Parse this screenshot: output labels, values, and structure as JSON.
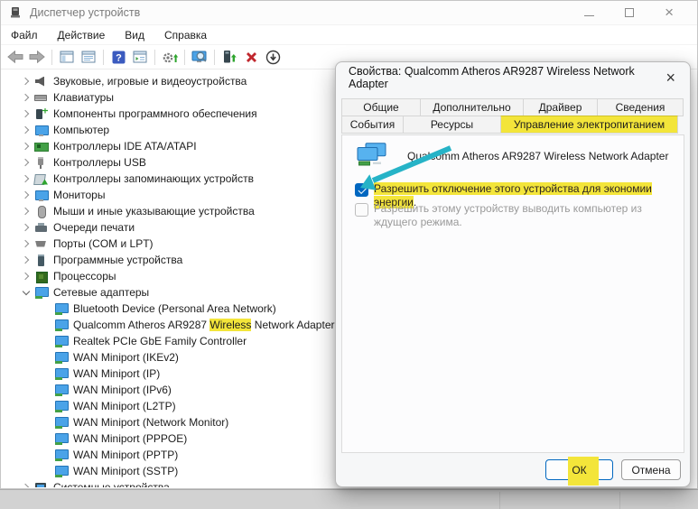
{
  "window": {
    "title": "Диспетчер устройств"
  },
  "menu": {
    "items": [
      "Файл",
      "Действие",
      "Вид",
      "Справка"
    ]
  },
  "toolbar": {
    "icons": [
      "back",
      "forward",
      "show-console-tree",
      "show-action-pane",
      "help",
      "export-list",
      "update-driver-settings",
      "scan-hardware-changes",
      "update-driver",
      "uninstall-device",
      "disable-device"
    ]
  },
  "tree": {
    "items": [
      {
        "label": "Звуковые, игровые и видеоустройства",
        "state": "collapsed"
      },
      {
        "label": "Клавиатуры",
        "state": "collapsed"
      },
      {
        "label": "Компоненты программного обеспечения",
        "state": "collapsed"
      },
      {
        "label": "Компьютер",
        "state": "collapsed"
      },
      {
        "label": "Контроллеры IDE ATA/ATAPI",
        "state": "collapsed"
      },
      {
        "label": "Контроллеры USB",
        "state": "collapsed"
      },
      {
        "label": "Контроллеры запоминающих устройств",
        "state": "collapsed"
      },
      {
        "label": "Мониторы",
        "state": "collapsed"
      },
      {
        "label": "Мыши и иные указывающие устройства",
        "state": "collapsed"
      },
      {
        "label": "Очереди печати",
        "state": "collapsed"
      },
      {
        "label": "Порты (COM и LPT)",
        "state": "collapsed"
      },
      {
        "label": "Программные устройства",
        "state": "collapsed"
      },
      {
        "label": "Процессоры",
        "state": "collapsed"
      },
      {
        "label": "Сетевые адаптеры",
        "state": "expanded"
      },
      {
        "label": "Bluetooth Device (Personal Area Network)",
        "state": "child"
      },
      {
        "label_pre": "Qualcomm Atheros AR9287 ",
        "label_highlight": "Wireless",
        "label_post": " Network Adapter",
        "state": "child"
      },
      {
        "label": "Realtek PCIe GbE Family Controller",
        "state": "child"
      },
      {
        "label": "WAN Miniport (IKEv2)",
        "state": "child"
      },
      {
        "label": "WAN Miniport (IP)",
        "state": "child"
      },
      {
        "label": "WAN Miniport (IPv6)",
        "state": "child"
      },
      {
        "label": "WAN Miniport (L2TP)",
        "state": "child"
      },
      {
        "label": "WAN Miniport (Network Monitor)",
        "state": "child"
      },
      {
        "label": "WAN Miniport (PPPOE)",
        "state": "child"
      },
      {
        "label": "WAN Miniport (PPTP)",
        "state": "child"
      },
      {
        "label": "WAN Miniport (SSTP)",
        "state": "child"
      },
      {
        "label": "Системные устройства",
        "state": "collapsed"
      }
    ]
  },
  "dialog": {
    "title": "Свойства: Qualcomm Atheros AR9287 Wireless Network Adapter",
    "close_glyph": "×",
    "tabs_row1": [
      "Общие",
      "Дополнительно",
      "Драйвер",
      "Сведения"
    ],
    "tabs_row2": [
      "События",
      "Ресурсы",
      "Управление электропитанием"
    ],
    "active_tab": "Управление электропитанием",
    "device_name": "Qualcomm Atheros AR9287 Wireless Network Adapter",
    "power_checkbox": {
      "label": "Разрешить отключение этого устройства для экономии энергии",
      "suffix": ".",
      "checked": true,
      "highlighted": true
    },
    "wake_checkbox": {
      "label": "Разрешить этому устройству выводить компьютер из ждущего режима.",
      "checked": false,
      "disabled": true
    },
    "ok_label": "ОК",
    "cancel_label": "Отмена"
  },
  "colors": {
    "highlight_yellow": "#f3e53a",
    "accent_blue": "#0067c0",
    "annotation_teal": "#26b3c7",
    "delete_red": "#c0272d"
  }
}
